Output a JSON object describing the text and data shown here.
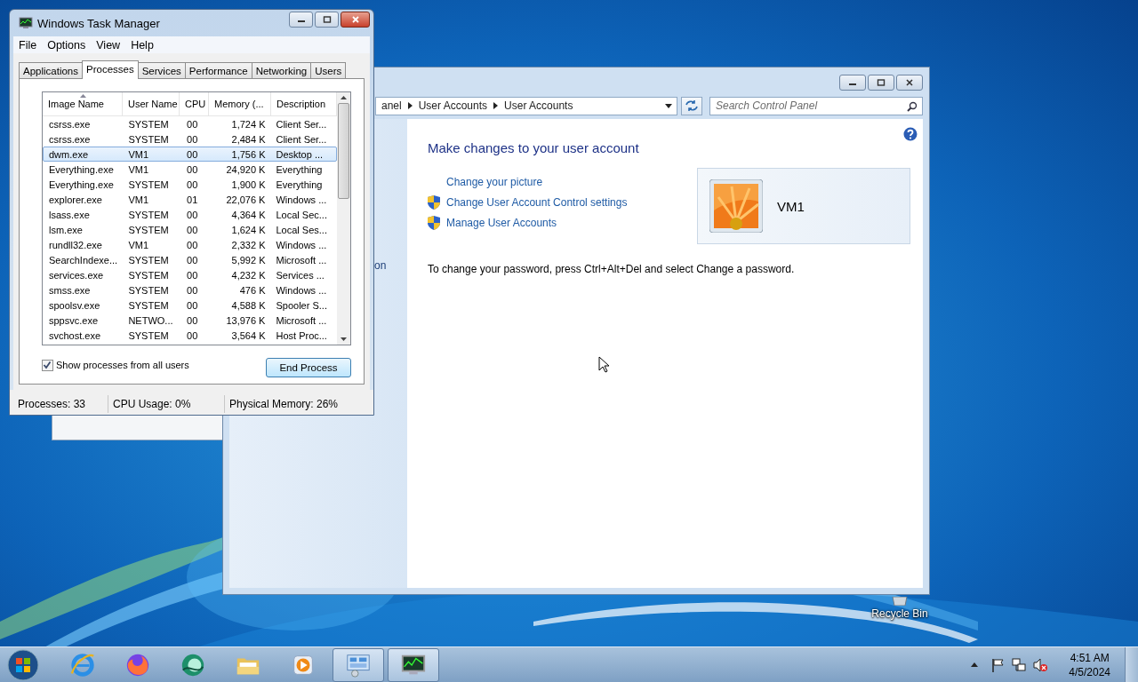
{
  "desktop": {
    "icons": [
      {
        "label": "Recycle Bin"
      }
    ]
  },
  "control_panel": {
    "breadcrumb": [
      "anel",
      "User Accounts",
      "User Accounts"
    ],
    "search": {
      "placeholder": "Search Control Panel"
    },
    "nav_fragment": "on",
    "heading": "Make changes to your user account",
    "links": [
      {
        "label": "Change your picture",
        "shield": false
      },
      {
        "label": "Change User Account Control settings",
        "shield": true
      },
      {
        "label": "Manage User Accounts",
        "shield": true
      }
    ],
    "account": {
      "name": "VM1"
    },
    "note": "To change your password, press Ctrl+Alt+Del and select Change a password."
  },
  "task_manager": {
    "title": "Windows Task Manager",
    "menu": [
      "File",
      "Options",
      "View",
      "Help"
    ],
    "tabs": [
      {
        "label": "Applications",
        "selected": false
      },
      {
        "label": "Processes",
        "selected": true
      },
      {
        "label": "Services",
        "selected": false
      },
      {
        "label": "Performance",
        "selected": false
      },
      {
        "label": "Networking",
        "selected": false
      },
      {
        "label": "Users",
        "selected": false
      }
    ],
    "columns": [
      "Image Name",
      "User Name",
      "CPU",
      "Memory (...",
      "Description"
    ],
    "rows": [
      {
        "cells": [
          "csrss.exe",
          "SYSTEM",
          "00",
          "1,724 K",
          "Client Ser..."
        ],
        "selected": false
      },
      {
        "cells": [
          "csrss.exe",
          "SYSTEM",
          "00",
          "2,484 K",
          "Client Ser..."
        ],
        "selected": false
      },
      {
        "cells": [
          "dwm.exe",
          "VM1",
          "00",
          "1,756 K",
          "Desktop ..."
        ],
        "selected": true
      },
      {
        "cells": [
          "Everything.exe",
          "VM1",
          "00",
          "24,920 K",
          "Everything"
        ],
        "selected": false
      },
      {
        "cells": [
          "Everything.exe",
          "SYSTEM",
          "00",
          "1,900 K",
          "Everything"
        ],
        "selected": false
      },
      {
        "cells": [
          "explorer.exe",
          "VM1",
          "01",
          "22,076 K",
          "Windows ..."
        ],
        "selected": false
      },
      {
        "cells": [
          "lsass.exe",
          "SYSTEM",
          "00",
          "4,364 K",
          "Local Sec..."
        ],
        "selected": false
      },
      {
        "cells": [
          "lsm.exe",
          "SYSTEM",
          "00",
          "1,624 K",
          "Local Ses..."
        ],
        "selected": false
      },
      {
        "cells": [
          "rundll32.exe",
          "VM1",
          "00",
          "2,332 K",
          "Windows ..."
        ],
        "selected": false
      },
      {
        "cells": [
          "SearchIndexe...",
          "SYSTEM",
          "00",
          "5,992 K",
          "Microsoft ..."
        ],
        "selected": false
      },
      {
        "cells": [
          "services.exe",
          "SYSTEM",
          "00",
          "4,232 K",
          "Services ..."
        ],
        "selected": false
      },
      {
        "cells": [
          "smss.exe",
          "SYSTEM",
          "00",
          "476 K",
          "Windows ..."
        ],
        "selected": false
      },
      {
        "cells": [
          "spoolsv.exe",
          "SYSTEM",
          "00",
          "4,588 K",
          "Spooler S..."
        ],
        "selected": false
      },
      {
        "cells": [
          "sppsvc.exe",
          "NETWO...",
          "00",
          "13,976 K",
          "Microsoft ..."
        ],
        "selected": false
      },
      {
        "cells": [
          "svchost.exe",
          "SYSTEM",
          "00",
          "3,564 K",
          "Host Proc..."
        ],
        "selected": false
      }
    ],
    "show_all": {
      "label": "Show processes from all users",
      "checked": true
    },
    "end_button": "End Process",
    "status": [
      "Processes: 33",
      "CPU Usage: 0%",
      "Physical Memory: 26%"
    ]
  },
  "taskbar": {
    "apps": [
      {
        "kind": "ie",
        "active": false
      },
      {
        "kind": "firefox",
        "active": false
      },
      {
        "kind": "globe",
        "active": false
      },
      {
        "kind": "folder",
        "active": false
      },
      {
        "kind": "media",
        "active": false
      },
      {
        "kind": "control",
        "active": true
      },
      {
        "kind": "taskmgr",
        "active": true
      }
    ],
    "clock": {
      "time": "4:51 AM",
      "date": "4/5/2024"
    }
  }
}
